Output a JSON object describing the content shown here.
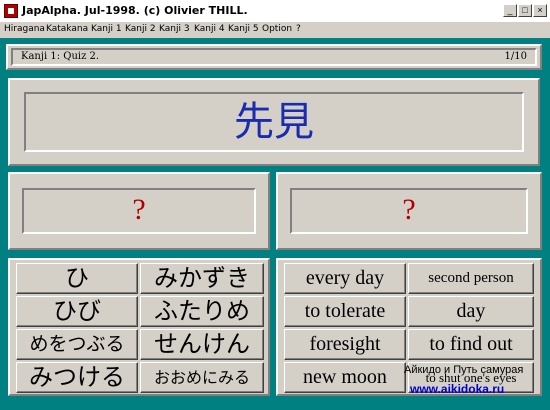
{
  "window": {
    "title": "JapAlpha. Jul-1998. (c) Olivier THILL.",
    "controls": {
      "minimize": "_",
      "maximize": "□",
      "close": "×"
    }
  },
  "menu": [
    "Hiragana",
    "Katakana",
    "Kanji 1",
    "Kanji 2",
    "Kanji 3",
    "Kanji 4",
    "Kanji 5",
    "Option",
    "?"
  ],
  "status": {
    "left": "Kanji 1:  Quiz 2.",
    "right": "1/10"
  },
  "question": {
    "kanji": "先見"
  },
  "answers": {
    "reading": "?",
    "meaning": "?"
  },
  "readings": [
    "ひ",
    "みかずき",
    "ひび",
    "ふたりめ",
    "めをつぶる",
    "せんけん",
    "みつける",
    "おおめにみる"
  ],
  "meanings": [
    "every day",
    "second person",
    "to tolerate",
    "day",
    "foresight",
    "to find out",
    "new moon",
    "to shut one's eyes"
  ],
  "watermark": {
    "line1": "Айкидо и Путь самурая",
    "line2": "www.aikidoka.ru"
  }
}
